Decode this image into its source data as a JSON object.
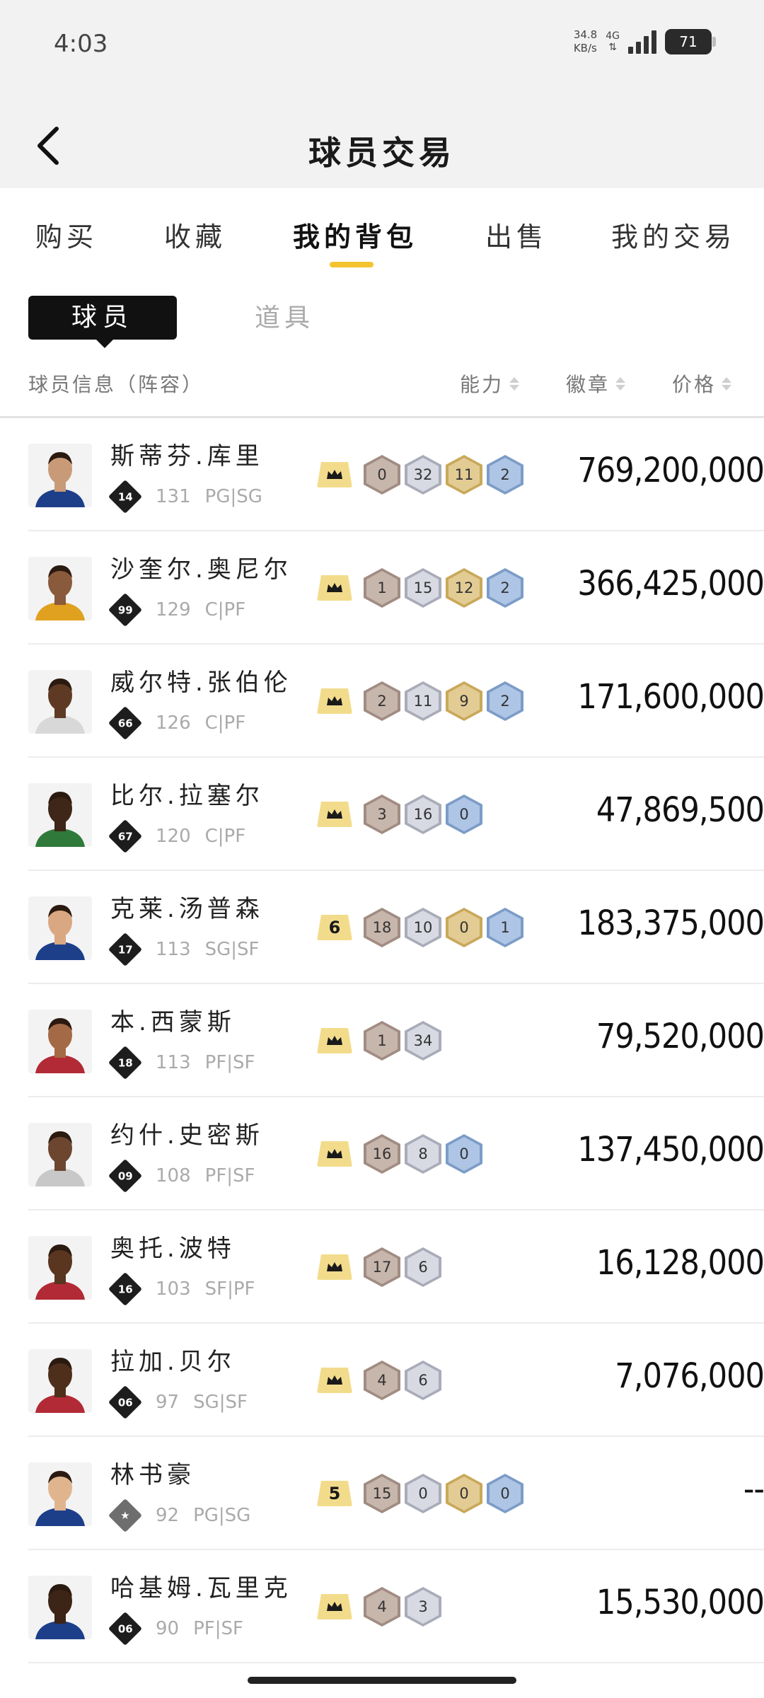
{
  "status": {
    "time": "4:03",
    "net_speed": "34.8",
    "net_unit": "KB/s",
    "net_type": "4G",
    "battery": "71"
  },
  "header": {
    "title": "球员交易"
  },
  "tabs": [
    {
      "label": "购买"
    },
    {
      "label": "收藏"
    },
    {
      "label": "我的背包"
    },
    {
      "label": "出售"
    },
    {
      "label": "我的交易"
    }
  ],
  "active_tab": "我的背包",
  "subtabs": {
    "players": "球员",
    "items": "道具"
  },
  "columns": {
    "info": "球员信息（阵容）",
    "ability": "能力",
    "badges": "徽章",
    "price": "价格"
  },
  "colors": {
    "accent": "#f4c430",
    "level_badge": "#f2dc8c",
    "bronze": "#c7b6ac",
    "silver": "#d8dae3",
    "gold": "#e2cc94",
    "blue": "#aec5e5"
  },
  "players": [
    {
      "name": "斯蒂芬.库里",
      "number": "14",
      "ability": "131",
      "position": "PG|SG",
      "level": "crown",
      "badges": [
        {
          "tier": "bronze",
          "count": "0"
        },
        {
          "tier": "silver",
          "count": "32"
        },
        {
          "tier": "gold",
          "count": "11"
        },
        {
          "tier": "blue",
          "count": "2"
        }
      ],
      "price": "769,200,000"
    },
    {
      "name": "沙奎尔.奥尼尔",
      "number": "99",
      "ability": "129",
      "position": "C|PF",
      "level": "crown",
      "badges": [
        {
          "tier": "bronze",
          "count": "1"
        },
        {
          "tier": "silver",
          "count": "15"
        },
        {
          "tier": "gold",
          "count": "12"
        },
        {
          "tier": "blue",
          "count": "2"
        }
      ],
      "price": "366,425,000"
    },
    {
      "name": "威尔特.张伯伦",
      "number": "66",
      "ability": "126",
      "position": "C|PF",
      "level": "crown",
      "badges": [
        {
          "tier": "bronze",
          "count": "2"
        },
        {
          "tier": "silver",
          "count": "11"
        },
        {
          "tier": "gold",
          "count": "9"
        },
        {
          "tier": "blue",
          "count": "2"
        }
      ],
      "price": "171,600,000"
    },
    {
      "name": "比尔.拉塞尔",
      "number": "67",
      "ability": "120",
      "position": "C|PF",
      "level": "crown",
      "badges": [
        {
          "tier": "bronze",
          "count": "3"
        },
        {
          "tier": "silver",
          "count": "16"
        },
        {
          "tier": "blue",
          "count": "0"
        }
      ],
      "price": "47,869,500"
    },
    {
      "name": "克莱.汤普森",
      "number": "17",
      "ability": "113",
      "position": "SG|SF",
      "level": "6",
      "badges": [
        {
          "tier": "bronze",
          "count": "18"
        },
        {
          "tier": "silver",
          "count": "10"
        },
        {
          "tier": "gold",
          "count": "0"
        },
        {
          "tier": "blue",
          "count": "1"
        }
      ],
      "price": "183,375,000"
    },
    {
      "name": "本.西蒙斯",
      "number": "18",
      "ability": "113",
      "position": "PF|SF",
      "level": "crown",
      "badges": [
        {
          "tier": "bronze",
          "count": "1"
        },
        {
          "tier": "silver",
          "count": "34"
        }
      ],
      "price": "79,520,000"
    },
    {
      "name": "约什.史密斯",
      "number": "09",
      "ability": "108",
      "position": "PF|SF",
      "level": "crown",
      "badges": [
        {
          "tier": "bronze",
          "count": "16"
        },
        {
          "tier": "silver",
          "count": "8"
        },
        {
          "tier": "blue",
          "count": "0"
        }
      ],
      "price": "137,450,000"
    },
    {
      "name": "奥托.波特",
      "number": "16",
      "ability": "103",
      "position": "SF|PF",
      "level": "crown",
      "badges": [
        {
          "tier": "bronze",
          "count": "17"
        },
        {
          "tier": "silver",
          "count": "6"
        }
      ],
      "price": "16,128,000"
    },
    {
      "name": "拉加.贝尔",
      "number": "06",
      "ability": "97",
      "position": "SG|SF",
      "level": "crown",
      "badges": [
        {
          "tier": "bronze",
          "count": "4"
        },
        {
          "tier": "silver",
          "count": "6"
        }
      ],
      "price": "7,076,000"
    },
    {
      "name": "林书豪",
      "number": "",
      "ability": "92",
      "position": "PG|SG",
      "level": "5",
      "badges": [
        {
          "tier": "bronze",
          "count": "15"
        },
        {
          "tier": "silver",
          "count": "0"
        },
        {
          "tier": "gold",
          "count": "0"
        },
        {
          "tier": "blue",
          "count": "0"
        }
      ],
      "price": "--"
    },
    {
      "name": "哈基姆.瓦里克",
      "number": "06",
      "ability": "90",
      "position": "PF|SF",
      "level": "crown",
      "badges": [
        {
          "tier": "bronze",
          "count": "4"
        },
        {
          "tier": "silver",
          "count": "3"
        }
      ],
      "price": "15,530,000"
    }
  ]
}
